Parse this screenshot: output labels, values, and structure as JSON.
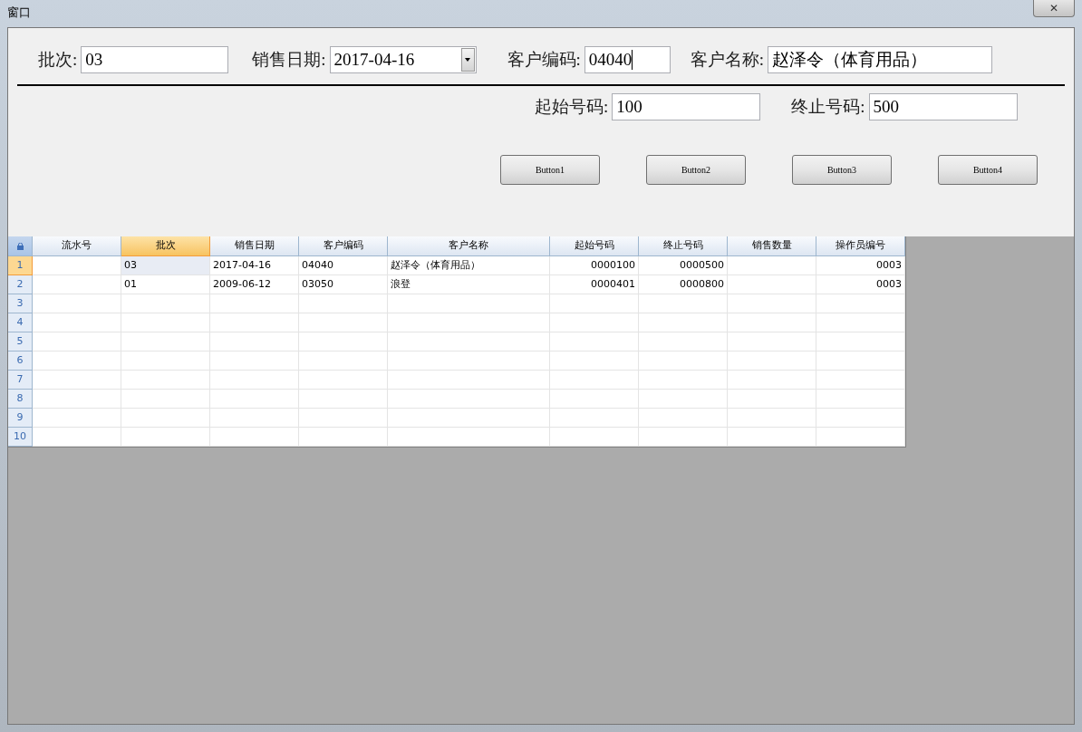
{
  "window": {
    "title": "窗口",
    "close_button": "✕"
  },
  "form": {
    "row_1": [
      {
        "kind": "text",
        "label": "批次:",
        "value": "03"
      },
      {
        "kind": "dropdown",
        "label": "销售日期:",
        "value": "2017-04-16"
      },
      {
        "kind": "text",
        "label": "客户编码:",
        "value": "04040",
        "focused": true
      },
      {
        "kind": "text",
        "label": "客户名称:",
        "value": "赵泽令（体育用品）"
      }
    ],
    "row_2": [
      {
        "kind": "text",
        "label": "起始号码:",
        "value": "100"
      },
      {
        "kind": "text",
        "label": "终止号码:",
        "value": "500"
      }
    ],
    "buttons": [
      "Button1",
      "Button2",
      "Button3",
      "Button4"
    ]
  },
  "grid": {
    "columns": [
      {
        "label": "流水号",
        "kind": "text",
        "selected": false
      },
      {
        "label": "批次",
        "kind": "text",
        "selected": true
      },
      {
        "label": "销售日期",
        "kind": "text",
        "selected": false
      },
      {
        "label": "客户编码",
        "kind": "text",
        "selected": false
      },
      {
        "label": "客户名称",
        "kind": "text",
        "selected": false
      },
      {
        "label": "起始号码",
        "kind": "number",
        "selected": false
      },
      {
        "label": "终止号码",
        "kind": "number",
        "selected": false
      },
      {
        "label": "销售数量",
        "kind": "number",
        "selected": false
      },
      {
        "label": "操作员编号",
        "kind": "number",
        "selected": false
      }
    ],
    "rows": [
      {
        "number": "1",
        "selected": true,
        "cells": [
          null,
          "03",
          "2017-04-16",
          "04040",
          "赵泽令（体育用品）",
          "0000100",
          "0000500",
          null,
          "0003"
        ]
      },
      {
        "number": "2",
        "selected": false,
        "cells": [
          null,
          "01",
          "2009-06-12",
          "03050",
          "浪登",
          "0000401",
          "0000800",
          null,
          "0003"
        ]
      },
      {
        "number": "3",
        "selected": false,
        "cells": []
      },
      {
        "number": "4",
        "selected": false,
        "cells": []
      },
      {
        "number": "5",
        "selected": false,
        "cells": []
      },
      {
        "number": "6",
        "selected": false,
        "cells": []
      },
      {
        "number": "7",
        "selected": false,
        "cells": []
      },
      {
        "number": "8",
        "selected": false,
        "cells": []
      },
      {
        "number": "9",
        "selected": false,
        "cells": []
      },
      {
        "number": "10",
        "selected": false,
        "cells": []
      }
    ]
  }
}
